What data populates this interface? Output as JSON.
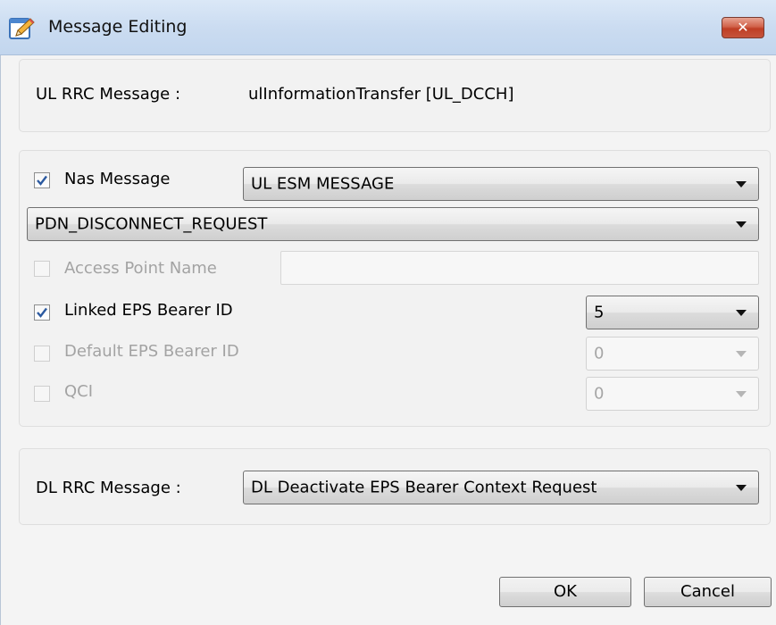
{
  "window": {
    "title": "Message Editing",
    "close_label": "✕"
  },
  "ul_section": {
    "label": "UL RRC Message :",
    "value": "ulInformationTransfer [UL_DCCH]"
  },
  "nas_section": {
    "nas_message": {
      "label": "Nas Message",
      "checked": true,
      "selected": "UL ESM MESSAGE"
    },
    "message_type": {
      "selected": "PDN_DISCONNECT_REQUEST"
    },
    "access_point_name": {
      "label": "Access Point Name",
      "checked": false,
      "enabled": false,
      "value": ""
    },
    "linked_eps_bearer_id": {
      "label": "Linked  EPS Bearer ID",
      "checked": true,
      "selected": "5"
    },
    "default_eps_bearer_id": {
      "label": "Default EPS Bearer ID",
      "checked": false,
      "enabled": false,
      "selected": "0"
    },
    "qci": {
      "label": "QCI",
      "checked": false,
      "enabled": false,
      "selected": "0"
    }
  },
  "dl_section": {
    "label": "DL RRC Message :",
    "selected": "DL Deactivate EPS Bearer Context Request"
  },
  "buttons": {
    "ok": "OK",
    "cancel": "Cancel"
  }
}
